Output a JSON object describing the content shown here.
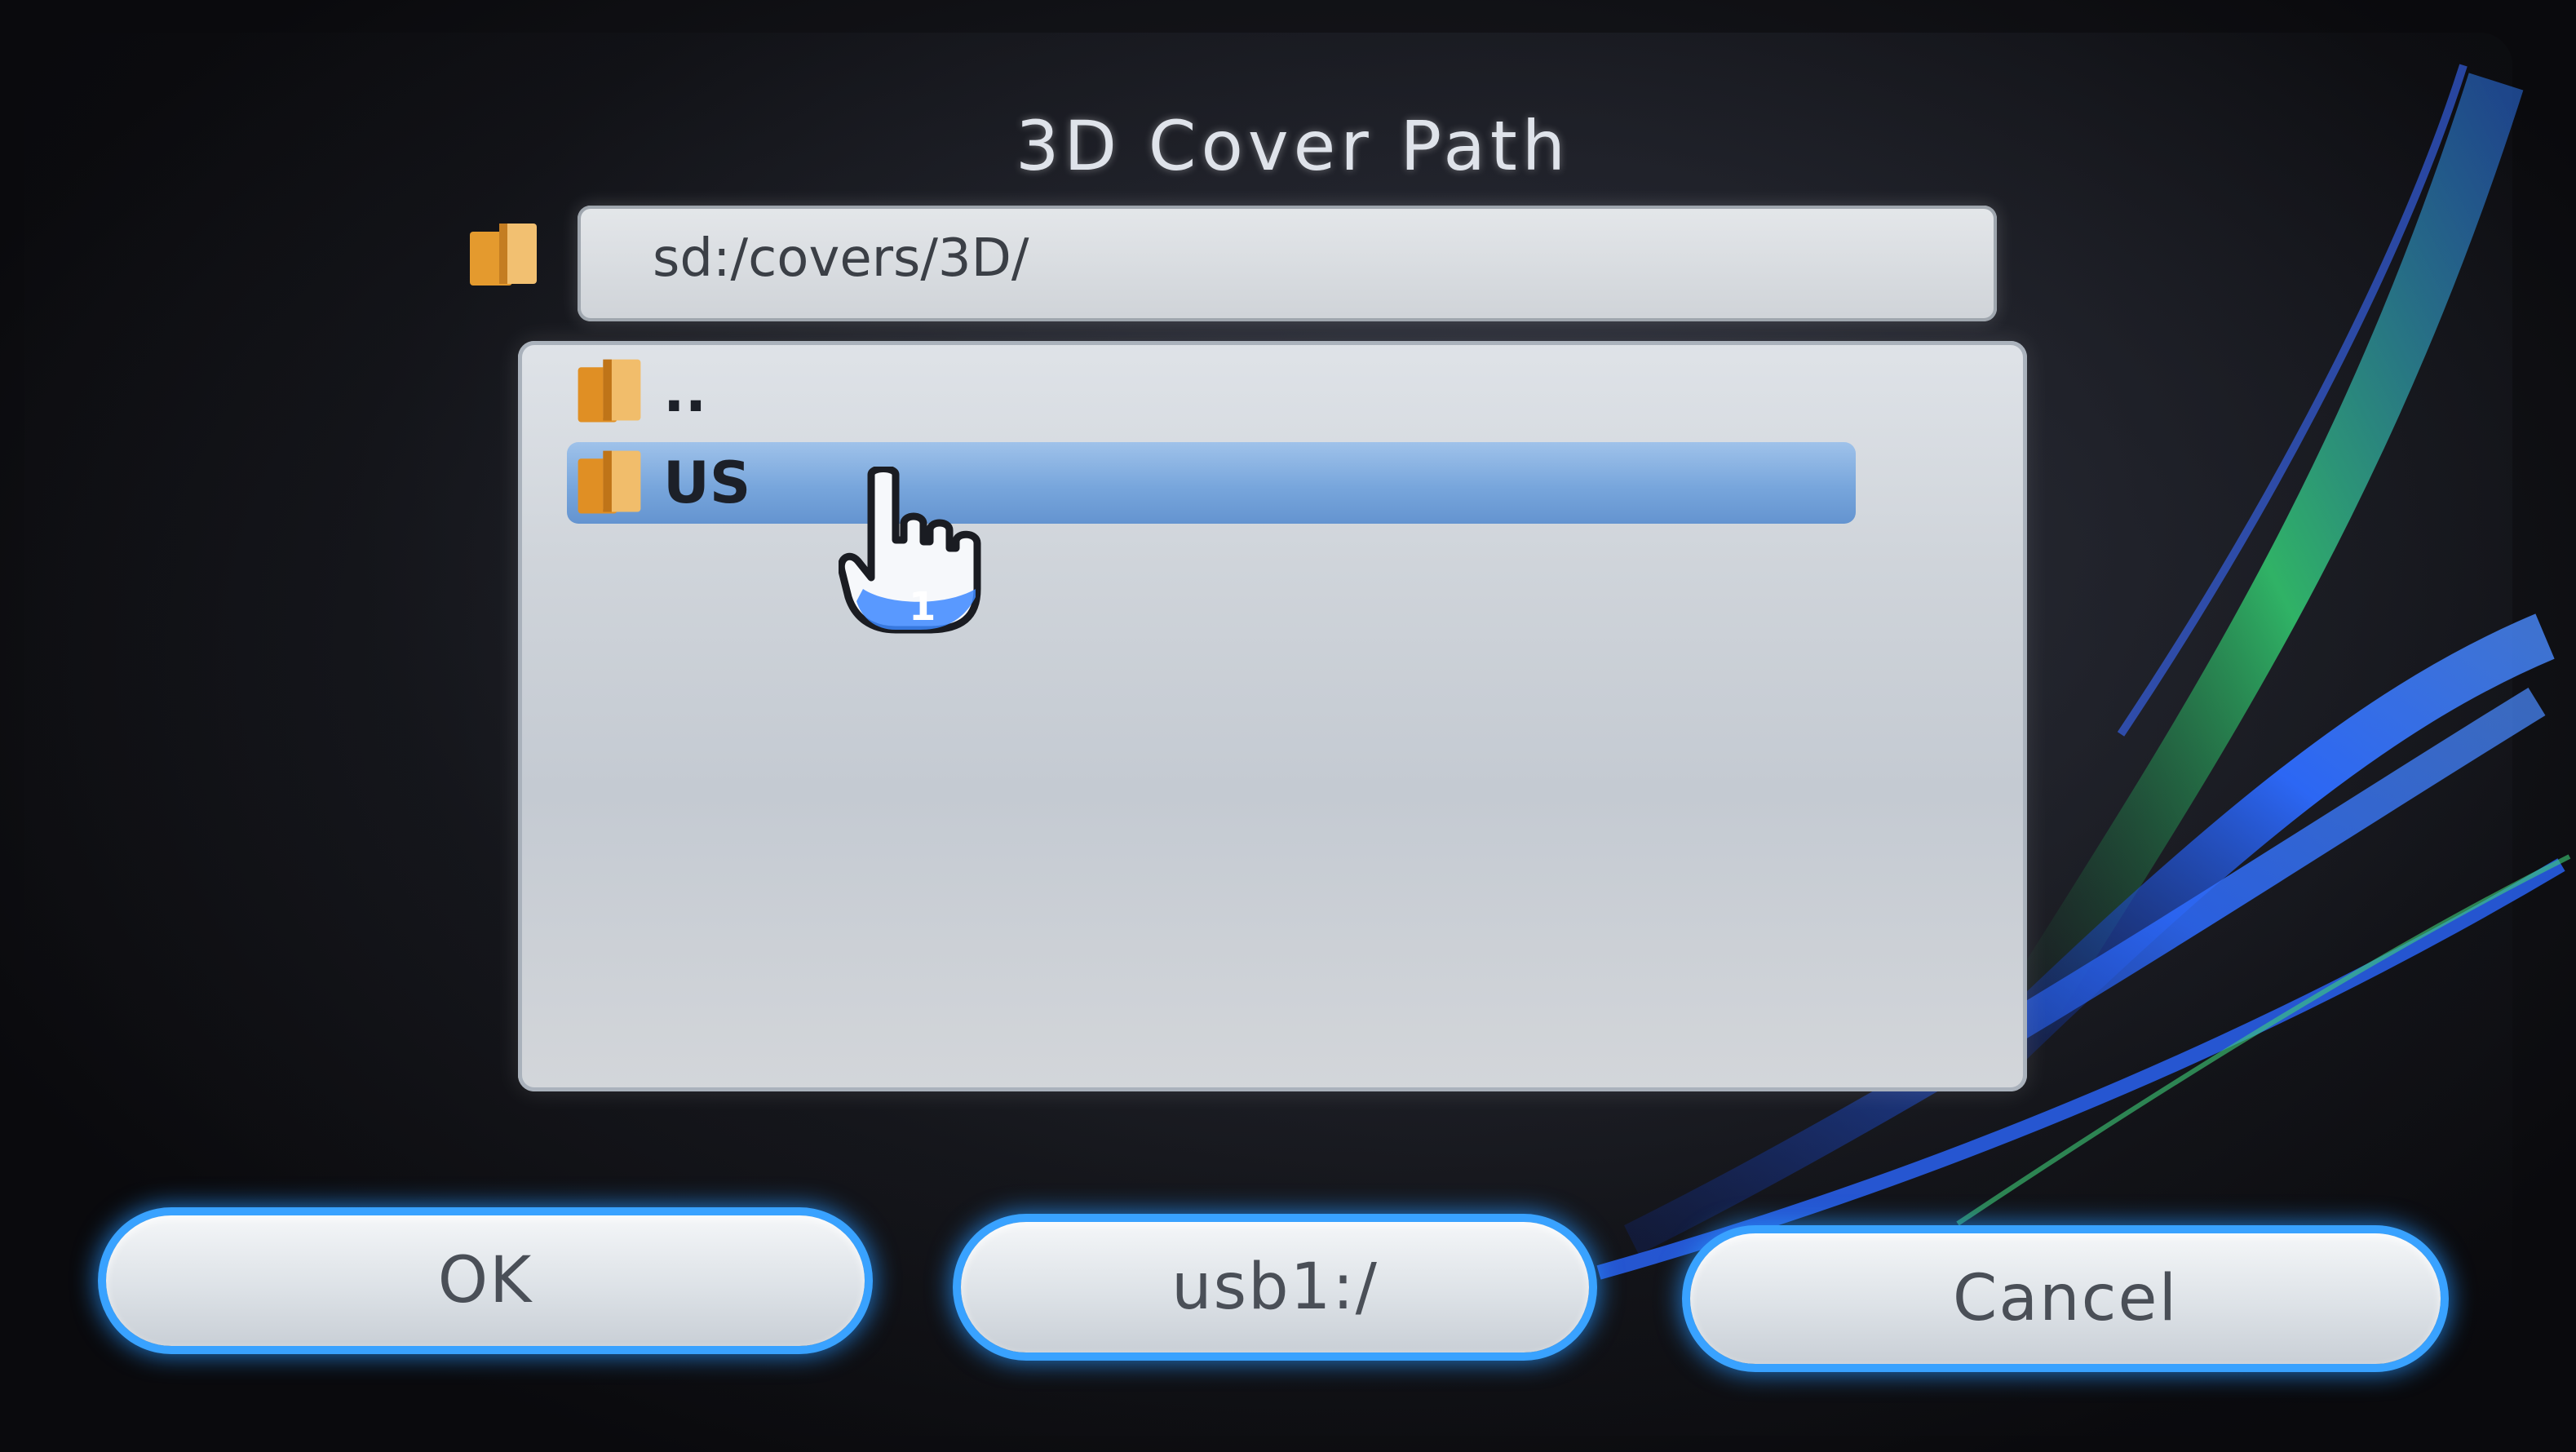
{
  "dialog": {
    "title": "3D Cover Path",
    "path_value": "sd:/covers/3D/"
  },
  "file_list": {
    "items": [
      {
        "label": "..",
        "icon": "folder-icon",
        "selected": false
      },
      {
        "label": "US",
        "icon": "folder-icon",
        "selected": true
      }
    ]
  },
  "cursor": {
    "player_number": "1"
  },
  "buttons": {
    "ok_label": "OK",
    "device_label": "usb1:/",
    "cancel_label": "Cancel"
  },
  "colors": {
    "accent_glow": "#39a2ff",
    "selection": "#78a6dc",
    "folder": "#e8a43a"
  }
}
